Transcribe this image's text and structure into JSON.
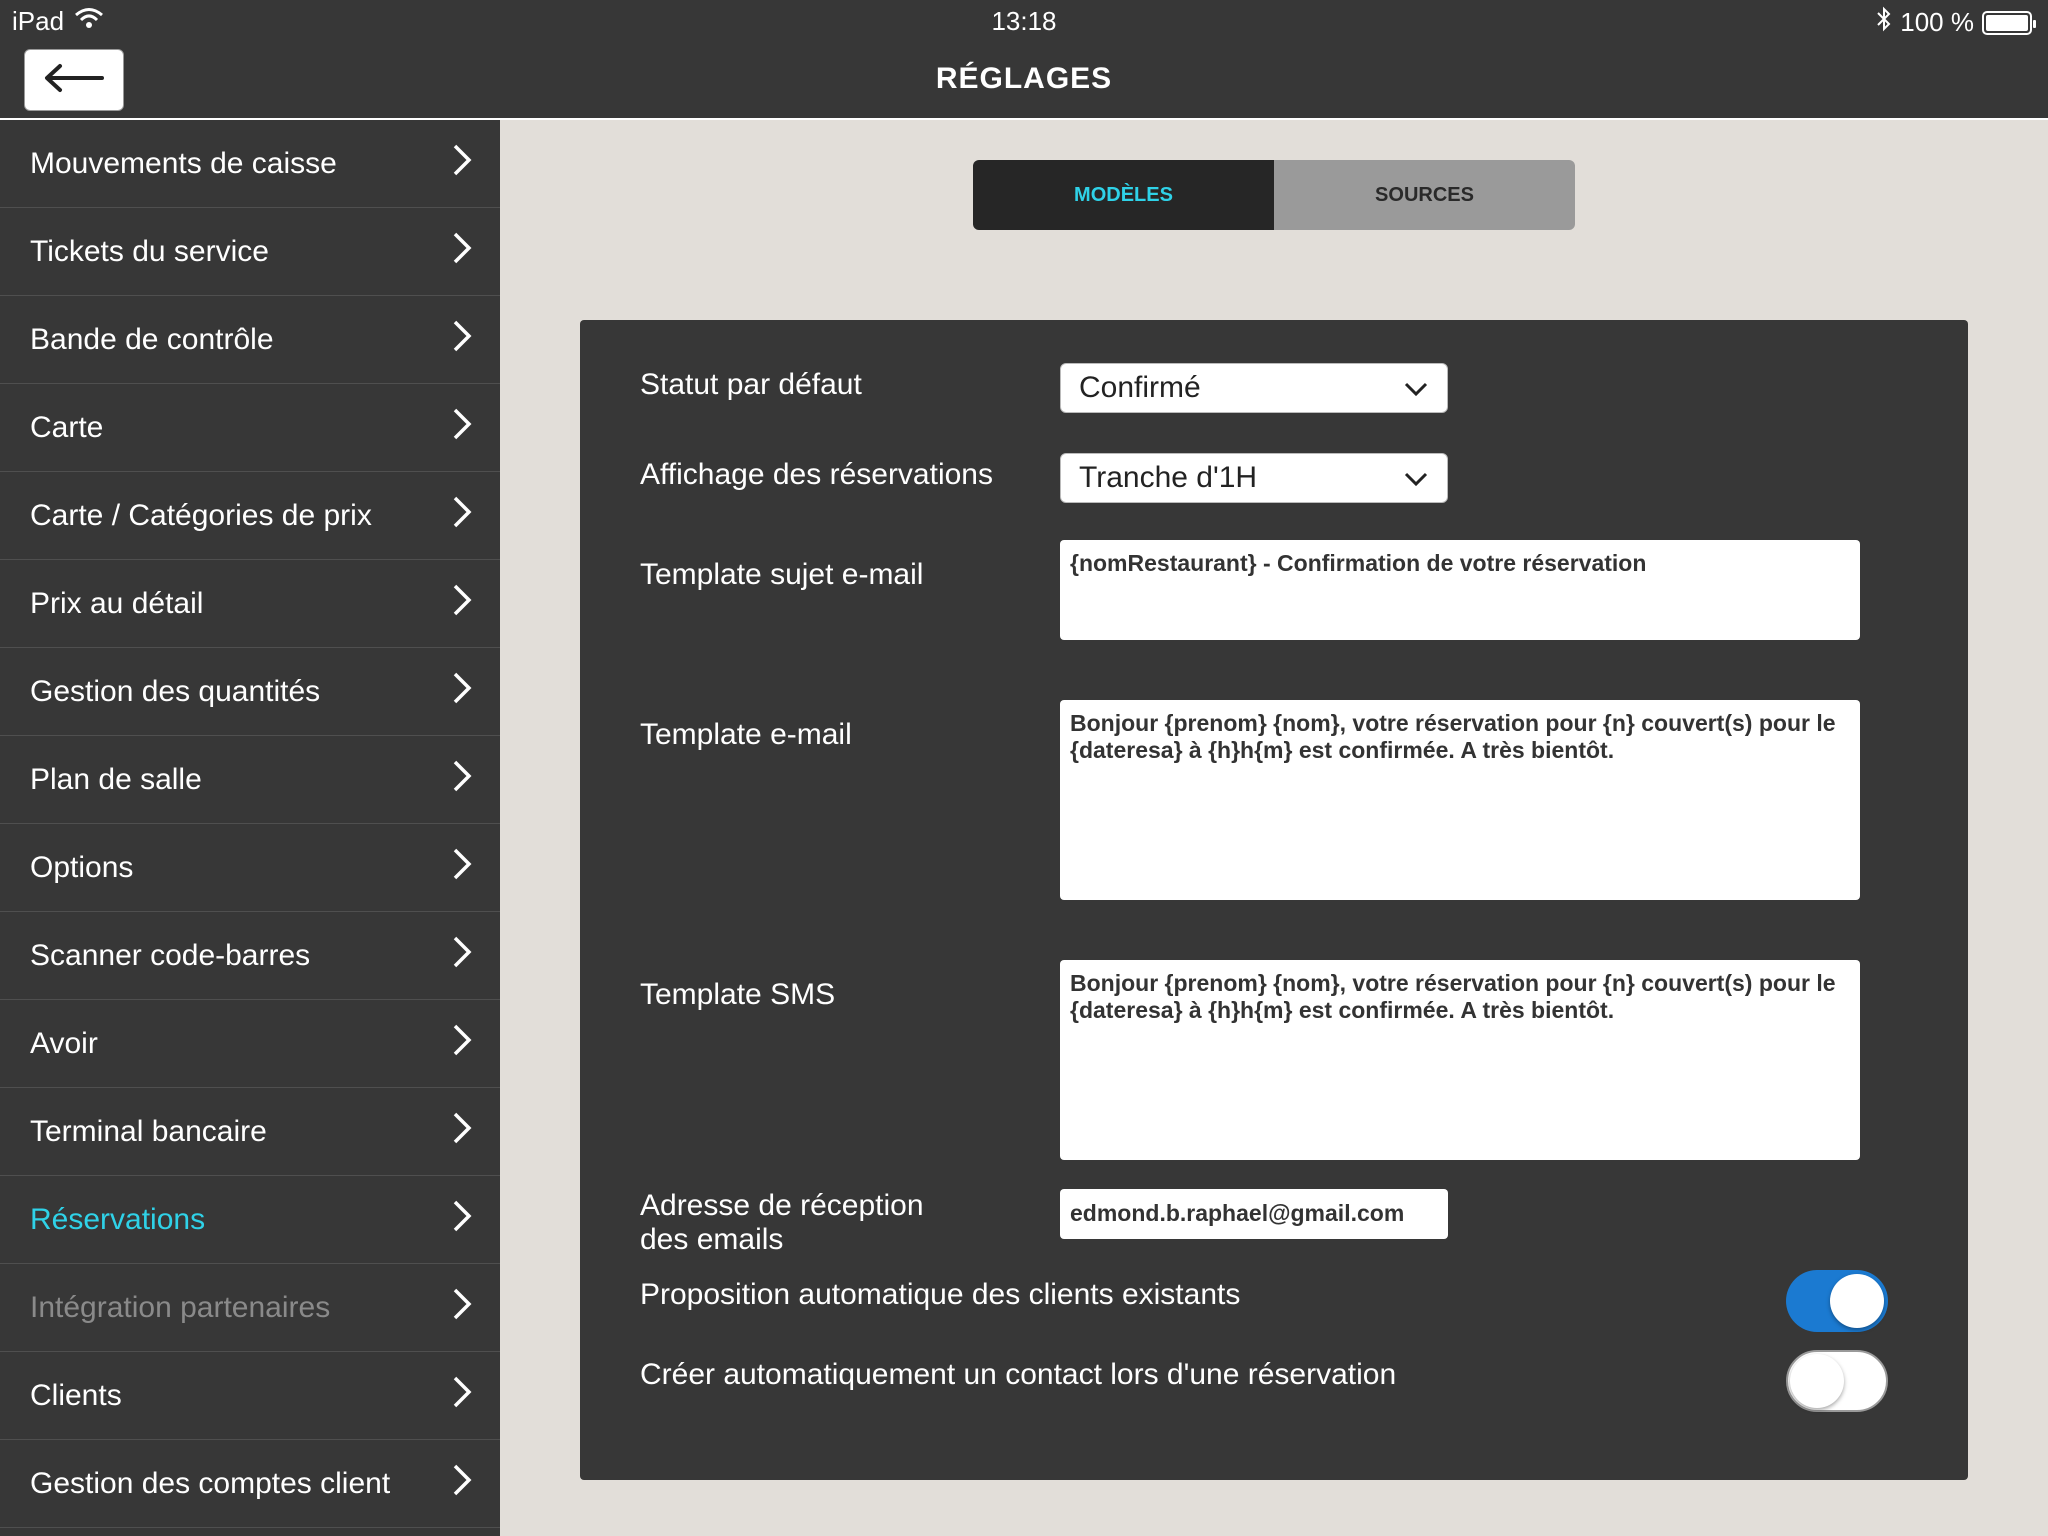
{
  "status_bar": {
    "device": "iPad",
    "time": "13:18",
    "battery": "100 %",
    "battery_level": 1.0
  },
  "nav": {
    "title": "RÉGLAGES",
    "back_icon": "arrow-left-icon"
  },
  "sidebar": {
    "items": [
      {
        "label": "Mouvements de caisse",
        "state": "normal"
      },
      {
        "label": "Tickets du service",
        "state": "normal"
      },
      {
        "label": "Bande de contrôle",
        "state": "normal"
      },
      {
        "label": "Carte",
        "state": "normal"
      },
      {
        "label": "Carte / Catégories de prix",
        "state": "normal"
      },
      {
        "label": "Prix au détail",
        "state": "normal"
      },
      {
        "label": "Gestion des quantités",
        "state": "normal"
      },
      {
        "label": "Plan de salle",
        "state": "normal"
      },
      {
        "label": "Options",
        "state": "normal"
      },
      {
        "label": "Scanner code-barres",
        "state": "normal"
      },
      {
        "label": "Avoir",
        "state": "normal"
      },
      {
        "label": "Terminal bancaire",
        "state": "normal"
      },
      {
        "label": "Réservations",
        "state": "active"
      },
      {
        "label": "Intégration partenaires",
        "state": "disabled"
      },
      {
        "label": "Clients",
        "state": "normal"
      },
      {
        "label": "Gestion des comptes client",
        "state": "normal"
      }
    ]
  },
  "tabs": {
    "models": "MODÈLES",
    "sources": "SOURCES",
    "selected": "models"
  },
  "form": {
    "default_status": {
      "label": "Statut par défaut",
      "value": "Confirmé"
    },
    "booking_display": {
      "label": "Affichage des réservations",
      "value": "Tranche d'1H"
    },
    "email_subject": {
      "label": "Template sujet e-mail",
      "value": "{nomRestaurant} - Confirmation de votre réservation"
    },
    "email_template": {
      "label": "Template e-mail",
      "value": "Bonjour {prenom} {nom}, votre réservation pour {n} couvert(s) pour le {dateresa} à {h}h{m} est confirmée. A très bientôt."
    },
    "sms_template": {
      "label": "Template SMS",
      "value": "Bonjour {prenom} {nom}, votre réservation pour {n} couvert(s) pour le {dateresa} à {h}h{m} est confirmée. A très bientôt."
    },
    "email_address": {
      "label_line1": "Adresse de réception",
      "label_line2": "des emails",
      "value": "edmond.b.raphael@gmail.com"
    },
    "auto_suggest": {
      "label": "Proposition automatique des clients existants",
      "on": true
    },
    "auto_create": {
      "label": "Créer automatiquement un contact lors d'une réservation",
      "on": false
    }
  },
  "colors": {
    "dark": "#373737",
    "accent": "#2fd2e8",
    "toggle_on": "#1b7ad1",
    "background": "#e2ded9"
  }
}
